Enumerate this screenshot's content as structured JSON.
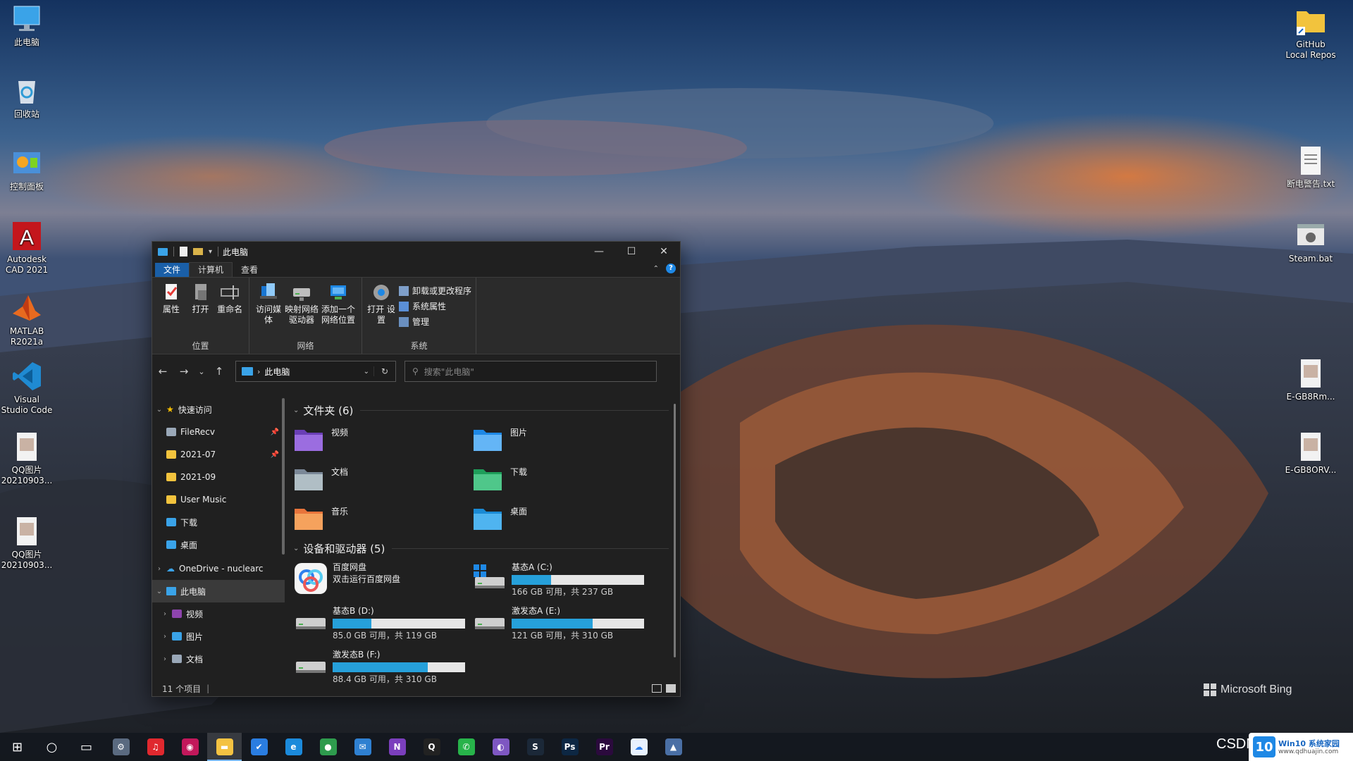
{
  "wallpaper": {
    "watermark": "Microsoft Bing"
  },
  "desktop": {
    "left_icons": [
      {
        "label": "此电脑",
        "icon": "computer-icon"
      },
      {
        "label": "回收站",
        "icon": "recycle-bin-icon"
      },
      {
        "label": "控制面板",
        "icon": "control-panel-icon"
      },
      {
        "label": "Autodesk CAD 2021",
        "icon": "autocad-icon"
      },
      {
        "label": "MATLAB R2021a",
        "icon": "matlab-icon"
      },
      {
        "label": "Visual Studio Code",
        "icon": "vscode-icon"
      },
      {
        "label": "QQ图片 20210903...",
        "icon": "image-file-icon"
      },
      {
        "label": "QQ图片 20210903...",
        "icon": "image-file-icon"
      }
    ],
    "right_icons": [
      {
        "label": "GitHub Local Repos",
        "icon": "folder-shortcut-icon"
      },
      {
        "label": "断电警告.txt",
        "icon": "text-file-icon"
      },
      {
        "label": "Steam.bat",
        "icon": "batch-file-icon"
      },
      {
        "label": "E-GB8Rm...",
        "icon": "image-file-icon"
      },
      {
        "label": "E-GB8ORV...",
        "icon": "image-file-icon"
      }
    ]
  },
  "explorer": {
    "title": "此电脑",
    "window_controls": {
      "minimize": "—",
      "maximize": "☐",
      "close": "✕"
    },
    "ribbon_tabs": [
      "文件",
      "计算机",
      "查看"
    ],
    "help": "?",
    "groups": {
      "location": {
        "label": "位置",
        "buttons": [
          {
            "label": "属性",
            "icon": "properties-icon"
          },
          {
            "label": "打开",
            "icon": "open-icon"
          },
          {
            "label": "重命名",
            "icon": "rename-icon"
          }
        ]
      },
      "network": {
        "label": "网络",
        "buttons": [
          {
            "label": "访问媒体",
            "icon": "media-access-icon"
          },
          {
            "label": "映射网络 驱动器",
            "icon": "map-drive-icon"
          },
          {
            "label": "添加一个 网络位置",
            "icon": "add-network-location-icon"
          }
        ]
      },
      "system": {
        "label": "系统",
        "open_settings": "打开 设置",
        "items": [
          "卸载或更改程序",
          "系统属性",
          "管理"
        ]
      }
    },
    "address": {
      "path": "此电脑"
    },
    "search": {
      "placeholder": "搜索\"此电脑\""
    },
    "nav": {
      "quick_access": "快速访问",
      "quick_items": [
        {
          "label": "FileRecv",
          "icon": "filerecv-icon",
          "pinned": true
        },
        {
          "label": "2021-07",
          "icon": "folder-icon",
          "pinned": true
        },
        {
          "label": "2021-09",
          "icon": "folder-icon",
          "pinned": false
        },
        {
          "label": "User Music",
          "icon": "folder-icon",
          "pinned": false
        },
        {
          "label": "下载",
          "icon": "download-icon",
          "pinned": false
        },
        {
          "label": "桌面",
          "icon": "desktop-icon",
          "pinned": false
        }
      ],
      "onedrive": "OneDrive - nuclearc",
      "this_pc": "此电脑",
      "pc_children": [
        "视频",
        "图片",
        "文档"
      ]
    },
    "folders_header": "文件夹 (6)",
    "folders": [
      {
        "name": "视频",
        "icon": "videos-folder-icon"
      },
      {
        "name": "图片",
        "icon": "pictures-folder-icon"
      },
      {
        "name": "文档",
        "icon": "documents-folder-icon"
      },
      {
        "name": "下载",
        "icon": "downloads-folder-icon"
      },
      {
        "name": "音乐",
        "icon": "music-folder-icon"
      },
      {
        "name": "桌面",
        "icon": "desktop-folder-icon"
      }
    ],
    "devices_header": "设备和驱动器 (5)",
    "drives": [
      {
        "name": "百度网盘",
        "subtitle": "双击运行百度网盘",
        "icon": "baidu-netdisk-icon"
      },
      {
        "name": "基态A (C:)",
        "capacity": "166 GB 可用，共 237 GB",
        "used_fraction": 0.3,
        "icon": "windows-drive-icon"
      },
      {
        "name": "基态B (D:)",
        "capacity": "85.0 GB 可用，共 119 GB",
        "used_fraction": 0.29,
        "icon": "hard-drive-icon"
      },
      {
        "name": "激发态A (E:)",
        "capacity": "121 GB 可用，共 310 GB",
        "used_fraction": 0.61,
        "icon": "hard-drive-icon"
      },
      {
        "name": "激发态B (F:)",
        "capacity": "88.4 GB 可用，共 310 GB",
        "used_fraction": 0.72,
        "icon": "hard-drive-icon"
      }
    ],
    "status": "11 个项目"
  },
  "taskbar": {
    "items": [
      {
        "name": "start-button",
        "glyph": "⊞",
        "color": "#ffffff"
      },
      {
        "name": "search-button",
        "glyph": "○",
        "color": "#ffffff"
      },
      {
        "name": "task-view-button",
        "glyph": "▭",
        "color": "#ffffff"
      },
      {
        "name": "settings-app",
        "glyph": "⚙",
        "color": "#5a6a80"
      },
      {
        "name": "netease-music-app",
        "glyph": "♫",
        "color": "#e0282e"
      },
      {
        "name": "music-player-app",
        "glyph": "◉",
        "color": "#c2185b"
      },
      {
        "name": "file-explorer-app",
        "glyph": "▬",
        "color": "#f4c242"
      },
      {
        "name": "todo-app",
        "glyph": "✔",
        "color": "#2a7de1"
      },
      {
        "name": "edge-app",
        "glyph": "e",
        "color": "#1b8adb"
      },
      {
        "name": "chrome-app",
        "glyph": "●",
        "color": "#2e9b4d"
      },
      {
        "name": "mail-app",
        "glyph": "✉",
        "color": "#2f80d1"
      },
      {
        "name": "onenote-app",
        "glyph": "N",
        "color": "#7b3fbd"
      },
      {
        "name": "qq-app",
        "glyph": "Q",
        "color": "#222222"
      },
      {
        "name": "wechat-app",
        "glyph": "✆",
        "color": "#27b34a"
      },
      {
        "name": "github-app",
        "glyph": "◐",
        "color": "#7e57c2"
      },
      {
        "name": "steam-app",
        "glyph": "S",
        "color": "#1b2838"
      },
      {
        "name": "photoshop-app",
        "glyph": "Ps",
        "color": "#0d2743"
      },
      {
        "name": "premiere-app",
        "glyph": "Pr",
        "color": "#2b0a3d"
      },
      {
        "name": "baidu-netdisk-app",
        "glyph": "☁",
        "color": "#e8f1ff"
      },
      {
        "name": "photos-app",
        "glyph": "▲",
        "color": "#4a6fa5"
      }
    ],
    "active_index": 6,
    "tray_text": "CSDN"
  },
  "badge": {
    "logo": "10",
    "title": "Win10 系统家园",
    "sub": "www.qdhuajin.com"
  }
}
